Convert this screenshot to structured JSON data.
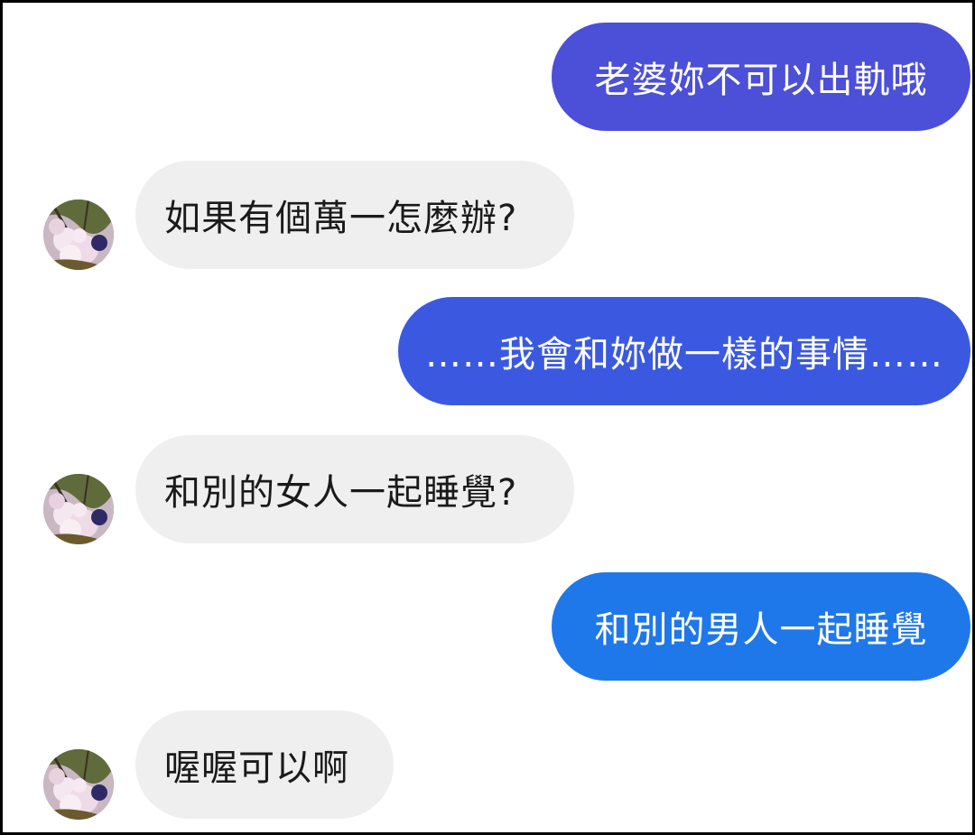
{
  "conversation": {
    "messages": [
      {
        "side": "sent",
        "text": "老婆妳不可以出軌哦",
        "color": "#4c4fd8"
      },
      {
        "side": "received",
        "text": "如果有個萬一怎麼辦?",
        "avatar": "cherry-blossom-avatar"
      },
      {
        "side": "sent",
        "text": "……我會和妳做一樣的事情……",
        "color": "#3b59e0"
      },
      {
        "side": "received",
        "text": "和別的女人一起睡覺?",
        "avatar": "cherry-blossom-avatar"
      },
      {
        "side": "sent",
        "text": "和別的男人一起睡覺",
        "color": "#1f78ea"
      },
      {
        "side": "received",
        "text": "喔喔可以啊",
        "avatar": "cherry-blossom-avatar"
      }
    ]
  },
  "colors": {
    "received_bubble": "#efefef",
    "received_text": "#1a1a1a",
    "sent_text": "#ffffff",
    "background": "#ffffff",
    "border": "#000000"
  }
}
